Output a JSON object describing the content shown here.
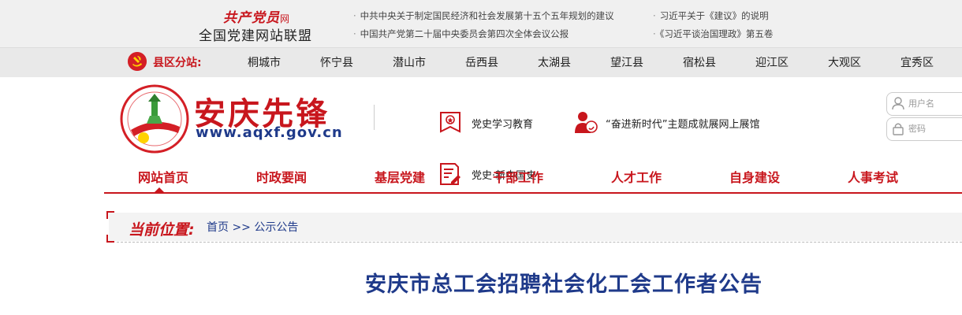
{
  "alliance": {
    "logo_text": "共产党员",
    "logo_suffix": "网",
    "title": "全国党建网站联盟",
    "links": [
      "中共中央关于制定国民经济和社会发展第十五个五年规划的建议",
      "中国共产党第二十届中央委员会第四次全体会议公报",
      "习近平关于《建议》的说明",
      "《习近平谈治国理政》第五卷"
    ]
  },
  "county_bar": {
    "label": "县区分站:",
    "items": [
      "桐城市",
      "怀宁县",
      "潜山市",
      "岳西县",
      "太湖县",
      "望江县",
      "宿松县",
      "迎江区",
      "大观区",
      "宜秀区"
    ]
  },
  "header": {
    "site_name": "安庆先锋",
    "site_url": "www.aqxf.gov.cn",
    "quick_links": [
      "党史学习教育",
      "“奋进新时代”主题成就展网上展馆",
      "党史·新中国史"
    ],
    "login": {
      "username_placeholder": "用户名",
      "password_placeholder": "密码"
    }
  },
  "nav": {
    "items": [
      "网站首页",
      "时政要闻",
      "基层党建",
      "干部工作",
      "人才工作",
      "自身建设",
      "人事考试"
    ],
    "active_index": 0
  },
  "location": {
    "label": "当前位置:",
    "home": "首页",
    "separator": ">>",
    "current": "公示公告"
  },
  "article": {
    "title": "安庆市总工会招聘社会化工会工作者公告"
  },
  "colors": {
    "brand_red": "#c8161d",
    "title_blue": "#1f3a8a",
    "topbar_bg": "#f0f0f0",
    "countybar_bg": "#e9e9e9"
  }
}
